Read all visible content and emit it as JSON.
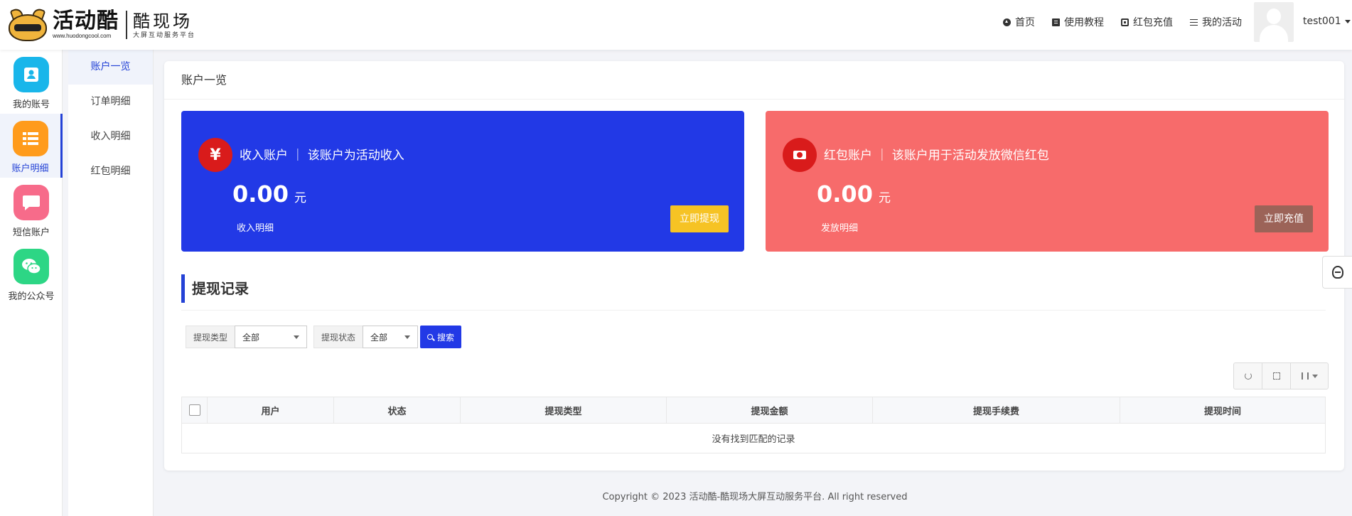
{
  "brand": {
    "name": "活动酷",
    "url": "www.huodongcool.com",
    "sub_title": "酷现场",
    "sub_tagline": "大屏互动服务平台"
  },
  "topnav": [
    {
      "label": "首页",
      "icon": "home-icon"
    },
    {
      "label": "使用教程",
      "icon": "book-icon"
    },
    {
      "label": "红包充值",
      "icon": "card-icon"
    },
    {
      "label": "我的活动",
      "icon": "list-icon"
    }
  ],
  "user": {
    "name": "test001"
  },
  "side1": [
    {
      "label": "我的账号",
      "color": "#19b6ea"
    },
    {
      "label": "账户明细",
      "color": "#ff9b1c"
    },
    {
      "label": "短信账户",
      "color": "#f76b8a"
    },
    {
      "label": "我的公众号",
      "color": "#2dd685"
    }
  ],
  "side2": [
    "账户一览",
    "订单明细",
    "收入明细",
    "红包明细"
  ],
  "panel": {
    "title": "账户一览"
  },
  "cards": [
    {
      "icon": "yuan-icon",
      "icon_text": "¥",
      "title": "收入账户 ｜ 该账户为活动收入",
      "amount": "0.00",
      "unit": "元",
      "link": "收入明细",
      "button": "立即提现",
      "color": "#2239e6"
    },
    {
      "icon": "cash-icon",
      "icon_text": "",
      "title": "红包账户 ｜ 该账户用于活动发放微信红包",
      "amount": "0.00",
      "unit": "元",
      "link": "发放明细",
      "button": "立即充值",
      "color": "#f76b6b"
    }
  ],
  "records": {
    "title": "提现记录",
    "filters": [
      {
        "label": "提现类型",
        "value": "全部"
      },
      {
        "label": "提现状态",
        "value": "全部"
      }
    ],
    "search_label": "搜索",
    "columns": [
      "用户",
      "状态",
      "提现类型",
      "提现金额",
      "提现手续费",
      "提现时间"
    ],
    "empty_text": "没有找到匹配的记录"
  },
  "footer": "Copyright © 2023 活动酷-酷现场大屏互动服务平台. All right reserved"
}
